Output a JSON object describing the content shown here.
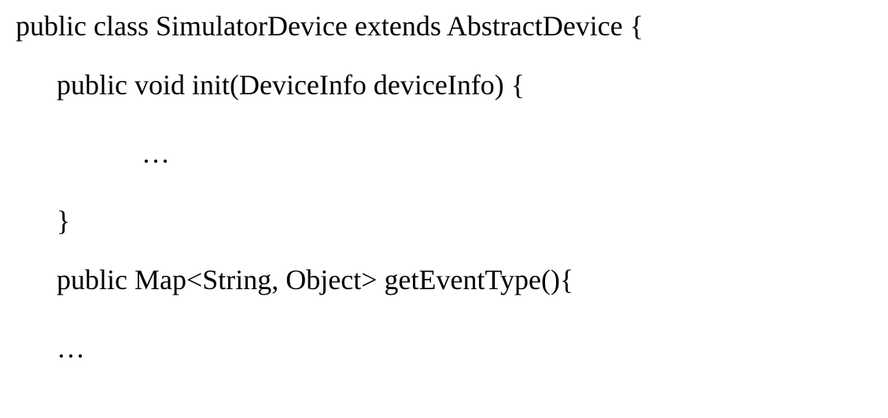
{
  "code": {
    "line1": "public class SimulatorDevice extends AbstractDevice {",
    "line2": "public void init(DeviceInfo deviceInfo) {",
    "line3": "…",
    "line4": "}",
    "line5": "public Map<String, Object> getEventType(){",
    "line6": "…"
  }
}
